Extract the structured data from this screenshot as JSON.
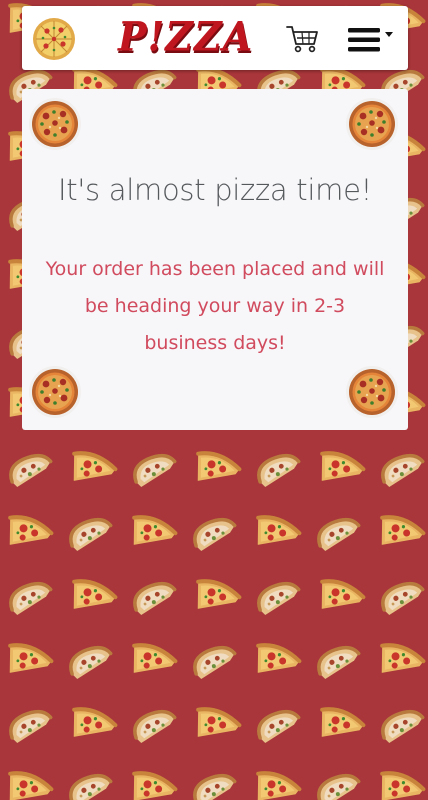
{
  "colors": {
    "page_background": "#a8363a",
    "brand_red": "#c0161f",
    "title_gray": "#55595c",
    "message_red": "#d14b5e",
    "card_background": "#f7f6f9"
  },
  "navbar": {
    "brand_text": "P!ZZA",
    "logo_icon": "pizza-icon",
    "cart_icon": "shopping-cart-icon",
    "menu_icon": "hamburger-menu-icon",
    "menu_caret_icon": "caret-down-icon"
  },
  "card": {
    "title": "It's almost pizza time!",
    "message": "Your order has been placed and will be heading your way in 2-3 business days!",
    "decoration_icon": "pizza-icon"
  },
  "background": {
    "pattern_icon": "pizza-slice-icon"
  }
}
